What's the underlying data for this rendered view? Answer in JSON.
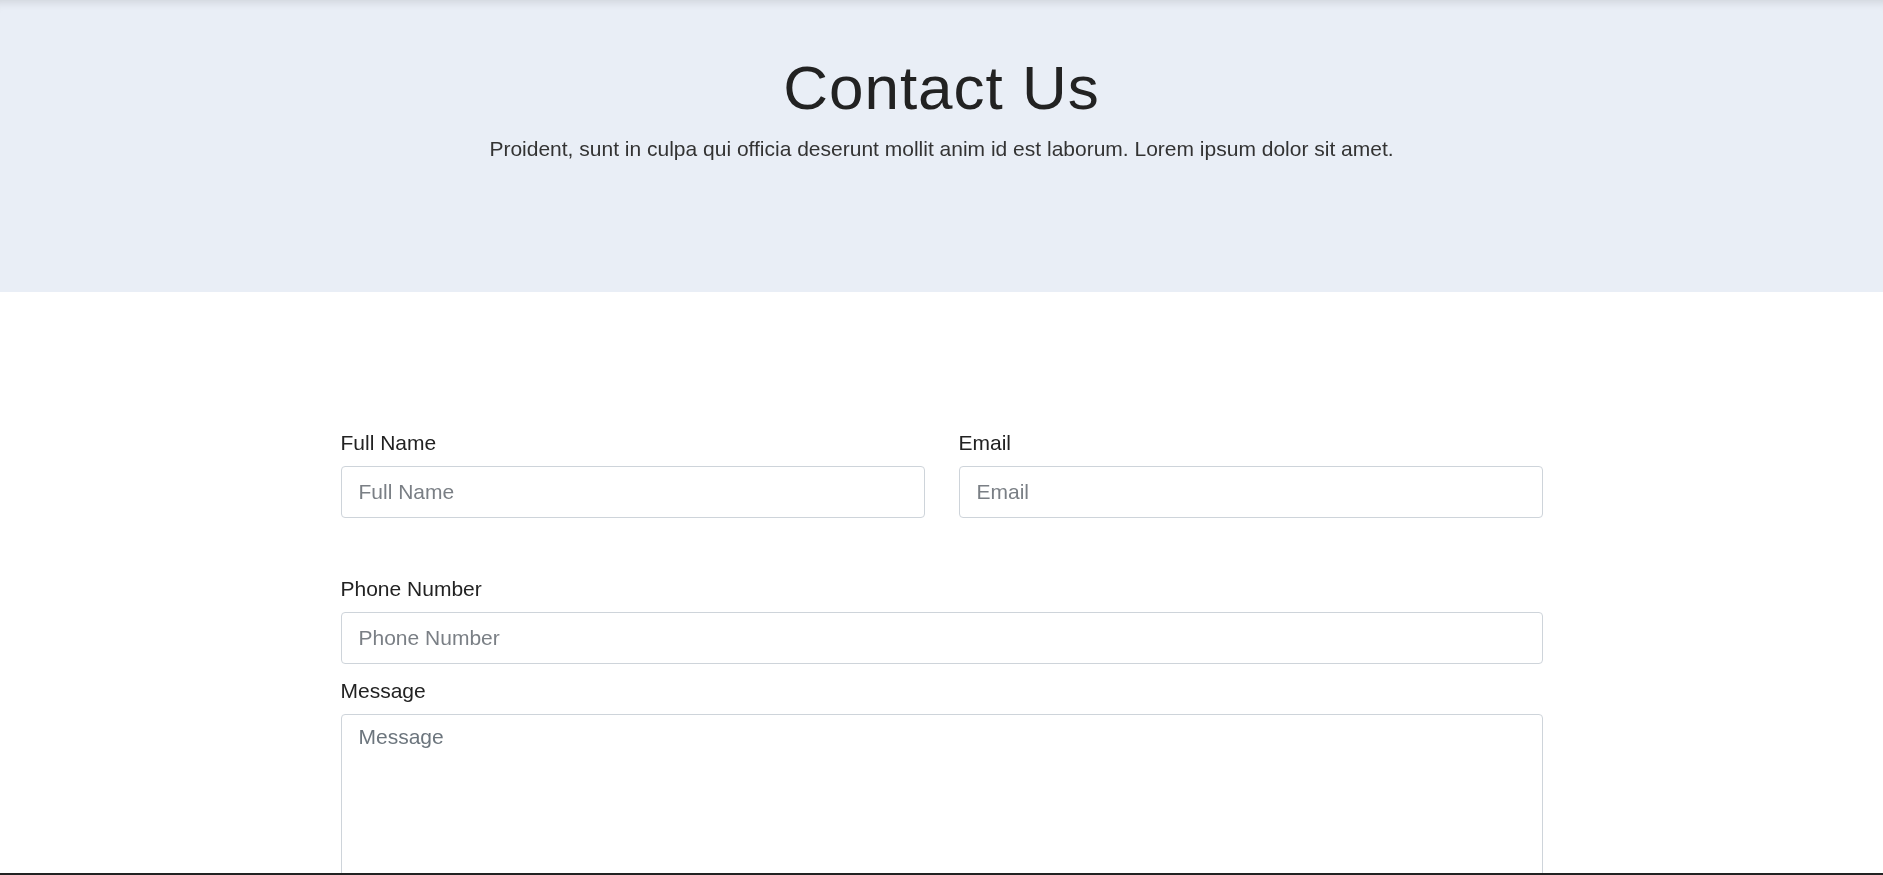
{
  "header": {
    "title": "Contact Us",
    "subtitle": "Proident, sunt in culpa qui officia deserunt mollit anim id est laborum. Lorem ipsum dolor sit amet."
  },
  "form": {
    "rows": [
      {
        "fields": [
          {
            "kind": "input",
            "label": "Full Name",
            "placeholder": "Full Name"
          },
          {
            "kind": "input",
            "label": "Email",
            "placeholder": "Email"
          }
        ]
      },
      {
        "fields": [
          {
            "kind": "input",
            "label": "Phone Number",
            "placeholder": "Phone Number"
          }
        ]
      },
      {
        "fields": [
          {
            "kind": "textarea",
            "label": "Message",
            "placeholder": "Message"
          }
        ]
      }
    ]
  }
}
